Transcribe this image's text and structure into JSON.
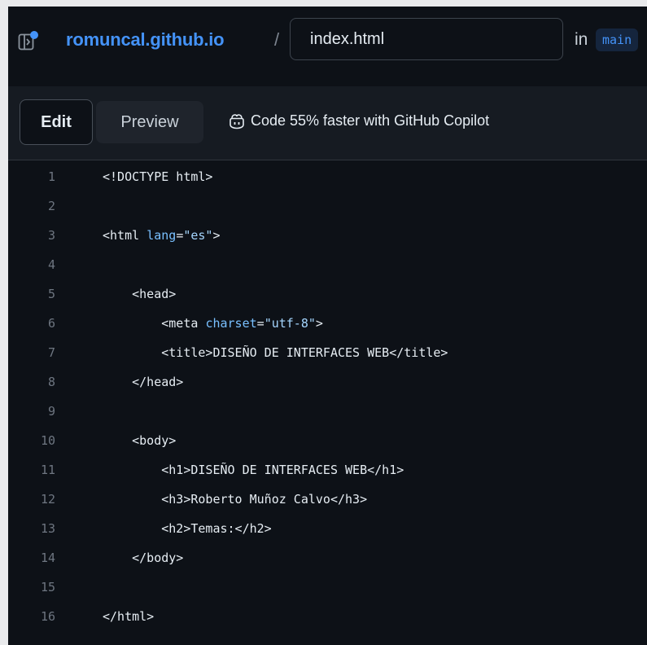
{
  "header": {
    "repo_name": "romuncal.github.io",
    "separator": "/",
    "filename": "index.html",
    "in_label": "in",
    "branch": "main"
  },
  "toolbar": {
    "edit_label": "Edit",
    "preview_label": "Preview",
    "copilot_text": "Code 55% faster with GitHub Copilot"
  },
  "editor": {
    "lines": [
      {
        "n": "1",
        "indent": "",
        "parts": [
          {
            "t": "<!DOCTYPE html>",
            "c": "tag"
          }
        ]
      },
      {
        "n": "2",
        "indent": "",
        "parts": []
      },
      {
        "n": "3",
        "indent": "",
        "parts": [
          {
            "t": "<html ",
            "c": "tag"
          },
          {
            "t": "lang",
            "c": "attr"
          },
          {
            "t": "=",
            "c": "tag"
          },
          {
            "t": "\"es\"",
            "c": "str"
          },
          {
            "t": ">",
            "c": "tag"
          }
        ]
      },
      {
        "n": "4",
        "indent": "",
        "parts": []
      },
      {
        "n": "5",
        "indent": "    ",
        "parts": [
          {
            "t": "<head>",
            "c": "tag"
          }
        ]
      },
      {
        "n": "6",
        "indent": "        ",
        "parts": [
          {
            "t": "<meta ",
            "c": "tag"
          },
          {
            "t": "charset",
            "c": "attr"
          },
          {
            "t": "=",
            "c": "tag"
          },
          {
            "t": "\"utf-8\"",
            "c": "str"
          },
          {
            "t": ">",
            "c": "tag"
          }
        ]
      },
      {
        "n": "7",
        "indent": "        ",
        "parts": [
          {
            "t": "<title>DISEÑO DE INTERFACES WEB</title>",
            "c": "tag"
          }
        ]
      },
      {
        "n": "8",
        "indent": "    ",
        "parts": [
          {
            "t": "</head>",
            "c": "tag"
          }
        ]
      },
      {
        "n": "9",
        "indent": "",
        "parts": []
      },
      {
        "n": "10",
        "indent": "    ",
        "parts": [
          {
            "t": "<body>",
            "c": "tag"
          }
        ]
      },
      {
        "n": "11",
        "indent": "        ",
        "parts": [
          {
            "t": "<h1>DISEÑO DE INTERFACES WEB</h1>",
            "c": "tag"
          }
        ]
      },
      {
        "n": "12",
        "indent": "        ",
        "parts": [
          {
            "t": "<h3>Roberto Muñoz Calvo</h3>",
            "c": "tag"
          }
        ]
      },
      {
        "n": "13",
        "indent": "        ",
        "parts": [
          {
            "t": "<h2>Temas:</h2>",
            "c": "tag"
          }
        ]
      },
      {
        "n": "14",
        "indent": "    ",
        "parts": [
          {
            "t": "</body>",
            "c": "tag"
          }
        ]
      },
      {
        "n": "15",
        "indent": "",
        "parts": []
      },
      {
        "n": "16",
        "indent": "",
        "parts": [
          {
            "t": "</html>",
            "c": "tag"
          }
        ]
      }
    ]
  },
  "colors": {
    "background": "#0d1117",
    "toolbar": "#161b22",
    "accent": "#4493f8",
    "attr": "#79c0ff",
    "string": "#a5d6ff",
    "line_number": "#6e7681"
  },
  "icons": {
    "file_tree": "file-tree-toggle-icon",
    "copilot": "copilot-icon"
  }
}
